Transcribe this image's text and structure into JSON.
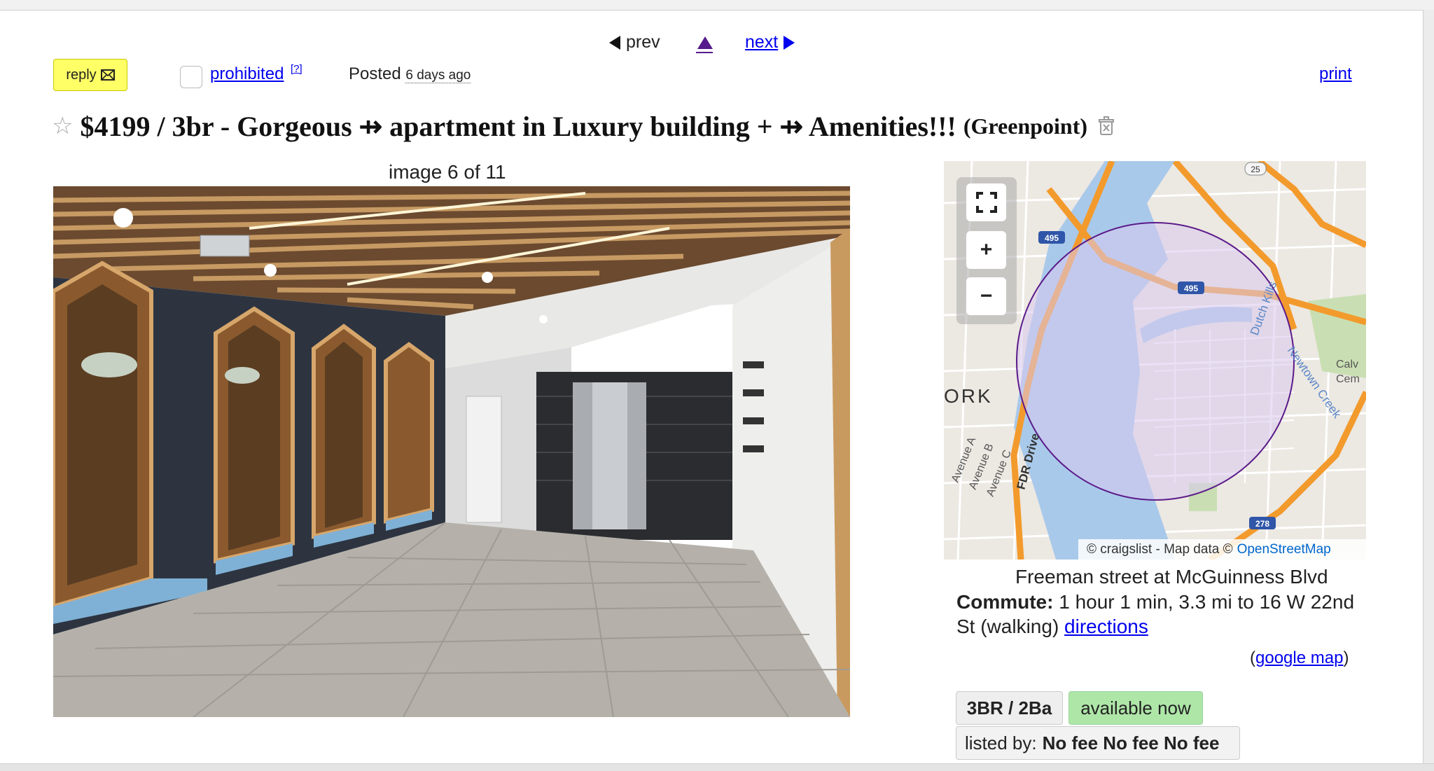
{
  "nav": {
    "prev": "prev",
    "next": "next"
  },
  "toolbar": {
    "reply": "reply",
    "prohibited": "prohibited",
    "prohibited_help": "[?]",
    "posted_label": "Posted",
    "posted_time": "6 days ago",
    "print": "print"
  },
  "post": {
    "title": "$4199 / 3br - Gorgeous ⇸ apartment in Luxury building + ⇸ Amenities!!!",
    "hood": "(Greenpoint)"
  },
  "gallery": {
    "counter": "image 6 of 11"
  },
  "map": {
    "attribution_prefix": "© craigslist - Map data ©",
    "attribution_link": "OpenStreetMap",
    "labels": {
      "york": "ORK",
      "fdr": "FDR Drive",
      "ave_a": "Avenue A",
      "ave_b": "Avenue B",
      "ave_c": "Avenue C",
      "dutch": "Dutch Kills",
      "newtown": "Newtown Creek",
      "calv1": "Calv",
      "calv2": "Cem",
      "s495": "495",
      "s278": "278",
      "s25": "25"
    },
    "zoom_in": "+",
    "zoom_out": "−"
  },
  "location": {
    "address": "Freeman street at McGuinness Blvd",
    "commute_label": "Commute:",
    "commute_text": "1 hour 1 min, 3.3 mi to 16 W 22nd St (walking)",
    "directions": "directions",
    "google_map": "google map"
  },
  "attrs": {
    "bedbath": "3BR / 2Ba",
    "availability": "available now",
    "listed_by_label": "listed by:",
    "listed_by_value": "No fee No fee No fee"
  },
  "colors": {
    "reply_bg": "#ffff66",
    "available_bg": "#aee6a8",
    "link": "#0000ee",
    "radius_circle": "#5b1a8a"
  }
}
